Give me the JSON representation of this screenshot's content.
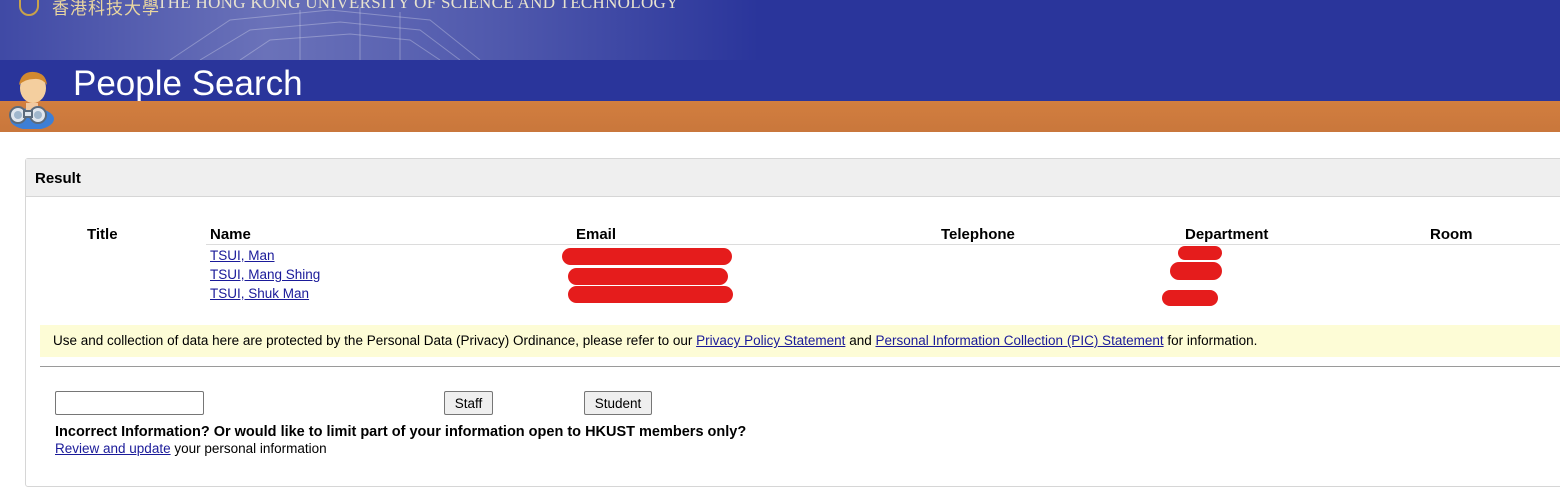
{
  "banner": {
    "university_chinese": "香港科技大學",
    "university_english": "THE HONG KONG UNIVERSITY OF SCIENCE AND TECHNOLOGY",
    "page_title": "People Search"
  },
  "result": {
    "panel_title": "Result",
    "columns": [
      "Title",
      "Name",
      "Email",
      "Telephone",
      "Department",
      "Room"
    ],
    "rows": [
      {
        "title": "",
        "name": "TSUI, Man",
        "email": "[redacted]",
        "telephone": "",
        "department": "[redacted]",
        "room": ""
      },
      {
        "title": "",
        "name": "TSUI, Mang Shing",
        "email": "[redacted]",
        "telephone": "",
        "department": "[redacted]",
        "room": ""
      },
      {
        "title": "",
        "name": "TSUI, Shuk Man",
        "email": "[redacted]",
        "telephone": "",
        "department": "[redacted]",
        "room": ""
      }
    ]
  },
  "privacy": {
    "text_before": "Use and collection of data here are protected by the Personal Data (Privacy) Ordinance, please refer to our ",
    "privacy_link": "Privacy Policy Statement",
    "text_and": " and ",
    "pic_link": "Personal Information Collection (PIC) Statement",
    "text_after": " for information."
  },
  "search": {
    "input_value": "",
    "staff_label": "Staff",
    "student_label": "Student"
  },
  "feedback": {
    "heading": "Incorrect Information? Or would like to limit part of your information open to HKUST members only?",
    "review_link": "Review and update",
    "review_suffix": " your personal information"
  },
  "colors": {
    "banner_blue": "#2a359b",
    "banner_orange": "#d27e3f",
    "link_blue": "#1a1a99",
    "notice_yellow": "#fdfcd6",
    "redaction_red": "#e51c1c"
  },
  "icons": [
    "hkust-logo-icon",
    "user-search-icon"
  ]
}
